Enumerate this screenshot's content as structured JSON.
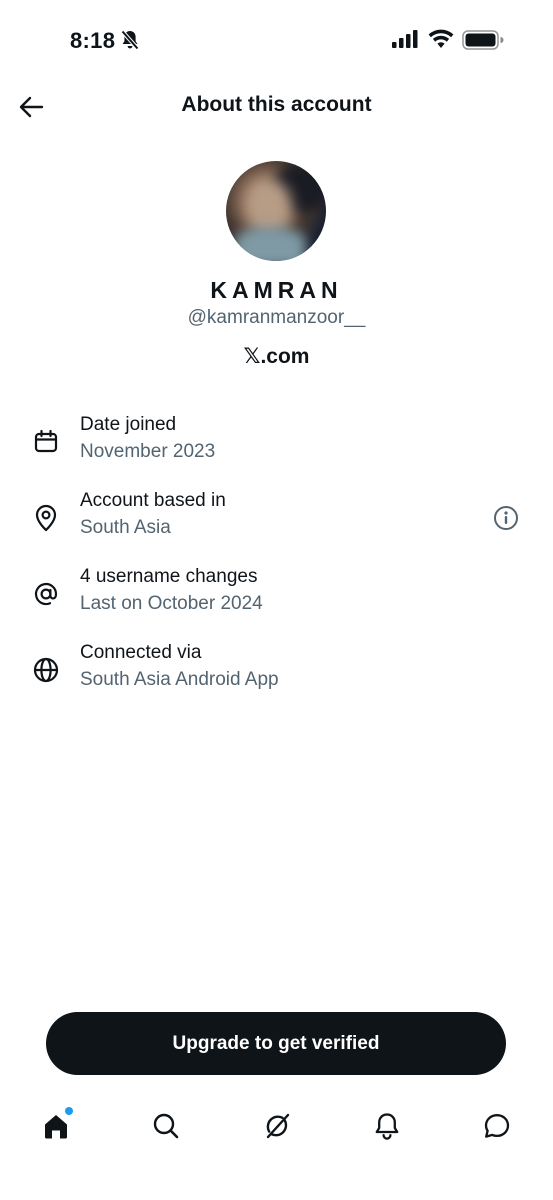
{
  "status_bar": {
    "time": "8:18",
    "icons": [
      "bell-slash-icon",
      "cellular-signal-icon",
      "wifi-icon",
      "battery-icon"
    ]
  },
  "header": {
    "title": "About this account",
    "back_icon": "arrow-left-icon"
  },
  "profile": {
    "display_name": "KAMRAN",
    "handle": "@kamranmanzoor__",
    "site": "𝕏.com"
  },
  "details": [
    {
      "icon": "calendar-icon",
      "label": "Date joined",
      "value": "November 2023"
    },
    {
      "icon": "location-pin-icon",
      "label": "Account based in",
      "value": "South Asia",
      "action_icon": "info-circle-icon"
    },
    {
      "icon": "at-sign-icon",
      "label": "4 username changes",
      "value": "Last on October 2024"
    },
    {
      "icon": "globe-icon",
      "label": "Connected via",
      "value": "South Asia Android App"
    }
  ],
  "cta": {
    "label": "Upgrade to get verified"
  },
  "tabbar": {
    "items": [
      "home-icon",
      "search-icon",
      "grok-icon",
      "notifications-icon",
      "messages-icon"
    ],
    "home_has_unread_dot": true
  },
  "colors": {
    "text_primary": "#0f1419",
    "text_secondary": "#536471",
    "button_bg": "#0f1419",
    "accent_dot": "#1d9bf0",
    "background": "#ffffff"
  }
}
